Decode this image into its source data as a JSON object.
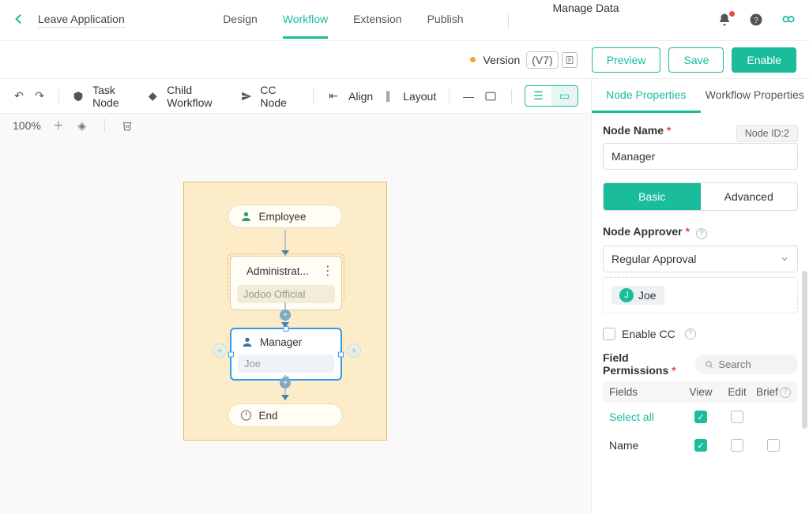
{
  "header": {
    "title": "Leave Application",
    "tabs": [
      "Design",
      "Workflow",
      "Extension",
      "Publish"
    ],
    "active_tab": 1,
    "manage_data": "Manage Data"
  },
  "subheader": {
    "version_label": "Version",
    "version_value": "(V7)",
    "preview": "Preview",
    "save": "Save",
    "enable": "Enable"
  },
  "toolbar": {
    "task_node": "Task Node",
    "child_workflow": "Child Workflow",
    "cc_node": "CC Node",
    "align": "Align",
    "layout": "Layout",
    "zoom": "100%"
  },
  "flow": {
    "start": {
      "label": "Employee"
    },
    "node_admin": {
      "label": "Administrat...",
      "assignee": "Jodoo Official"
    },
    "node_manager": {
      "label": "Manager",
      "assignee": "Joe"
    },
    "end": {
      "label": "End"
    }
  },
  "panel": {
    "tabs": {
      "node": "Node Properties",
      "workflow": "Workflow Properties",
      "active": "node"
    },
    "node_name_label": "Node Name",
    "node_id": "Node ID:2",
    "node_name_value": "Manager",
    "seg": {
      "basic": "Basic",
      "advanced": "Advanced",
      "active": "basic"
    },
    "approver_label": "Node Approver",
    "approver_type": "Regular Approval",
    "approver_chip": {
      "initial": "J",
      "name": "Joe"
    },
    "enable_cc_label": "Enable CC",
    "enable_cc_checked": false,
    "field_perm_label": "Field Permissions",
    "search_placeholder": "Search",
    "cols": {
      "fields": "Fields",
      "view": "View",
      "edit": "Edit",
      "brief": "Brief"
    },
    "rows": [
      {
        "name": "Select all",
        "view": true,
        "edit": false,
        "brief": null,
        "select_all": true
      },
      {
        "name": "Name",
        "view": true,
        "edit": false,
        "brief": false
      }
    ]
  }
}
